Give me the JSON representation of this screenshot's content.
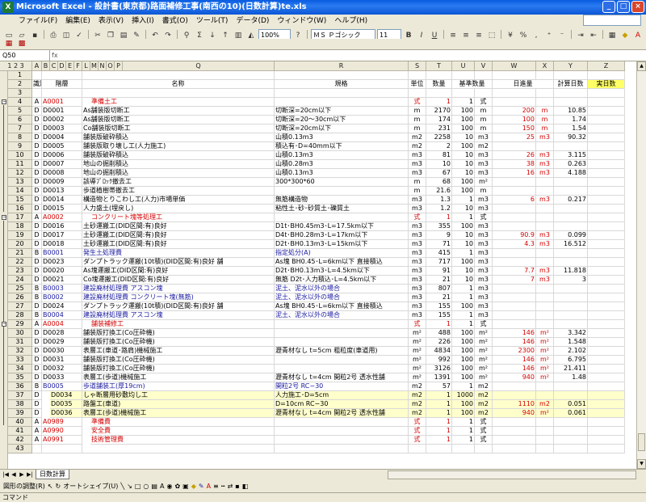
{
  "window": {
    "title": "Microsoft Excel - 設計書(東京都)路面補修工事(南西の10)(日数計算)te.xls"
  },
  "menu": [
    "ファイル(F)",
    "編集(E)",
    "表示(V)",
    "挿入(I)",
    "書式(O)",
    "ツール(T)",
    "データ(D)",
    "ウィンドウ(W)",
    "ヘルプ(H)"
  ],
  "toolbar": {
    "zoom": "100%",
    "font": "ＭＳ Ｐゴシック",
    "size": "11"
  },
  "formula": {
    "namebox": "Q50",
    "fx": "fx"
  },
  "columns": [
    {
      "k": "A",
      "w": 12
    },
    {
      "k": "B",
      "w": 10
    },
    {
      "k": "C",
      "w": 10
    },
    {
      "k": "D",
      "w": 10
    },
    {
      "k": "E",
      "w": 10
    },
    {
      "k": "F",
      "w": 10
    },
    {
      "k": "L",
      "w": 10
    },
    {
      "k": "M",
      "w": 10
    },
    {
      "k": "N",
      "w": 10
    },
    {
      "k": "O",
      "w": 10
    },
    {
      "k": "P",
      "w": 10
    },
    {
      "k": "Q",
      "w": 188
    },
    {
      "k": "R",
      "w": 166
    },
    {
      "k": "S",
      "w": 22
    },
    {
      "k": "T",
      "w": 32
    },
    {
      "k": "U",
      "w": 28
    },
    {
      "k": "V",
      "w": 22
    },
    {
      "k": "W",
      "w": 54
    },
    {
      "k": "X",
      "w": 22
    },
    {
      "k": "Y",
      "w": 42
    },
    {
      "k": "Z",
      "w": 46
    }
  ],
  "header_row": {
    "a": "識別",
    "b": "階層",
    "q": "名称",
    "r": "規格",
    "s": "単位",
    "t": "数量",
    "u": "基準数量",
    "w": "日進量",
    "y": "計算日数",
    "z": "実日数"
  },
  "rows": [
    {
      "n": "1"
    },
    {
      "n": "2"
    },
    {
      "n": "3"
    },
    {
      "n": "4",
      "a": "A",
      "b": "A0001",
      "q": "準備土工",
      "s": "式",
      "t": "1",
      "u": "1",
      "v": "式",
      "ac": "red"
    },
    {
      "n": "5",
      "a": "D",
      "b": "D0001",
      "q": "As舗装版切断工",
      "r": "切断深=20cm以下",
      "s": "m",
      "t": "2170",
      "u": "100",
      "v": "m",
      "w": "200",
      "x": "m",
      "y": "10.85"
    },
    {
      "n": "6",
      "a": "D",
      "b": "D0002",
      "q": "As舗装版切断工",
      "r": "切断深=20〜30cm以下",
      "s": "m",
      "t": "174",
      "u": "100",
      "v": "m",
      "w": "100",
      "x": "m",
      "y": "1.74"
    },
    {
      "n": "7",
      "a": "D",
      "b": "D0003",
      "q": "Co舗装版切断工",
      "r": "切断深=20cm以下",
      "s": "m",
      "t": "231",
      "u": "100",
      "v": "m",
      "w": "150",
      "x": "m",
      "y": "1.54"
    },
    {
      "n": "8",
      "a": "D",
      "b": "D0004",
      "q": "舗装版破砕積込",
      "r": "山積0.13m3",
      "s": "m2",
      "t": "2258",
      "u": "10",
      "v": "m3",
      "w": "25",
      "x": "m3",
      "y": "90.32"
    },
    {
      "n": "9",
      "a": "D",
      "b": "D0005",
      "q": "舗装版取り壊し工(人力施工)",
      "r": "積込有･D=40mm以下",
      "s": "m2",
      "t": "2",
      "u": "100",
      "v": "m2"
    },
    {
      "n": "10",
      "a": "D",
      "b": "D0006",
      "q": "舗装版破砕積込",
      "r": "山積0.13m3",
      "s": "m3",
      "t": "81",
      "u": "10",
      "v": "m3",
      "w": "26",
      "x": "m3",
      "y": "3.115"
    },
    {
      "n": "11",
      "a": "D",
      "b": "D0007",
      "q": "地山の掘削積込",
      "r": "山積0.28m3",
      "s": "m3",
      "t": "10",
      "u": "10",
      "v": "m3",
      "w": "38",
      "x": "m3",
      "y": "0.263"
    },
    {
      "n": "12",
      "a": "D",
      "b": "D0008",
      "q": "地山の掘削積込",
      "r": "山積0.13m3",
      "s": "m3",
      "t": "67",
      "u": "10",
      "v": "m3",
      "w": "16",
      "x": "m3",
      "y": "4.188"
    },
    {
      "n": "13",
      "a": "D",
      "b": "D0009",
      "q": "該導ﾌﾞﾛｯｸ撤去工",
      "r": "300*300*60",
      "s": "m",
      "t": "68",
      "u": "100",
      "v": "m²"
    },
    {
      "n": "14",
      "a": "D",
      "b": "D0013",
      "q": "歩道植樹帯撤去工",
      "s": "m",
      "t": "21.6",
      "u": "100",
      "v": "m"
    },
    {
      "n": "15",
      "a": "D",
      "b": "D0014",
      "q": "構造物とりこわし工(人力)市場単価",
      "r": "無筋構造物",
      "s": "m3",
      "t": "1.3",
      "u": "1",
      "v": "m3",
      "w": "6",
      "x": "m3",
      "y": "0.217"
    },
    {
      "n": "16",
      "a": "D",
      "b": "D0015",
      "q": "人力盛土(埋戻し)",
      "r": "粘性土･砂･砂質土･礫質土",
      "s": "m3",
      "t": "1.2",
      "u": "10",
      "v": "m3"
    },
    {
      "n": "17",
      "a": "A",
      "b": "A0002",
      "q": "コンクリート塊等処理工",
      "s": "式",
      "t": "1",
      "u": "1",
      "v": "式",
      "ac": "red"
    },
    {
      "n": "18",
      "a": "D",
      "b": "D0016",
      "q": "土砂運搬工(DID区間:有)良好",
      "r": "D1t･BH0.45m3･L=17.5km以下",
      "s": "m3",
      "t": "355",
      "u": "100",
      "v": "m3"
    },
    {
      "n": "19",
      "a": "D",
      "b": "D0017",
      "q": "土砂運搬工(DID区間:有)良好",
      "r": "D4t･BH0.28m3･L=17km以下",
      "s": "m3",
      "t": "9",
      "u": "10",
      "v": "m3",
      "w": "90.9",
      "x": "m3",
      "y": "0.099"
    },
    {
      "n": "20",
      "a": "D",
      "b": "D0018",
      "q": "土砂運搬工(DID区間:有)良好",
      "r": "D2t･BH0.13m3･L=15km以下",
      "s": "m3",
      "t": "71",
      "u": "10",
      "v": "m3",
      "w": "4.3",
      "x": "m3",
      "y": "16.512"
    },
    {
      "n": "21",
      "a": "B",
      "b": "B0001",
      "q": "発生土処理費",
      "r": "指定処分(A)",
      "s": "m3",
      "t": "415",
      "u": "1",
      "v": "m3",
      "bc": "blue"
    },
    {
      "n": "22",
      "a": "D",
      "b": "D0023",
      "q": "ダンプトラック運搬(10t積)(DID区間:有)良好 舗",
      "r": "As塊 BH0.45･L=6km以下 直接積込",
      "s": "m3",
      "t": "717",
      "u": "100",
      "v": "m3"
    },
    {
      "n": "23",
      "a": "D",
      "b": "D0020",
      "q": "As塊運搬工(DID区間:有)良好",
      "r": "D2t･BH0.13m3･L=4.5km以下",
      "s": "m3",
      "t": "91",
      "u": "10",
      "v": "m3",
      "w": "7.7",
      "x": "m3",
      "y": "11.818"
    },
    {
      "n": "24",
      "a": "D",
      "b": "D0021",
      "q": "Co塊運搬工(DID区間:有)良好",
      "r": "無筋 D2t･人力積込･L=4.5km以下",
      "s": "m3",
      "t": "21",
      "u": "10",
      "v": "m3",
      "w": "7",
      "x": "m3",
      "y": "3"
    },
    {
      "n": "25",
      "a": "B",
      "b": "B0003",
      "q": "建設廃材処理費 アスコン塊",
      "r": "泥土、泥水以外の場合",
      "s": "m3",
      "t": "807",
      "u": "1",
      "v": "m3",
      "bc": "blue"
    },
    {
      "n": "26",
      "a": "B",
      "b": "B0002",
      "q": "建設廃材処理費 コンクリート塊(無筋)",
      "r": "泥土、泥水以外の場合",
      "s": "m3",
      "t": "21",
      "u": "1",
      "v": "m3",
      "bc": "blue"
    },
    {
      "n": "27",
      "a": "D",
      "b": "D0024",
      "q": "ダンプトラック運搬(10t積)(DID区間:有)良好 舗",
      "r": "As塊 BH0.45･L=6km以下 直接積込",
      "s": "m3",
      "t": "155",
      "u": "100",
      "v": "m3"
    },
    {
      "n": "28",
      "a": "B",
      "b": "B0004",
      "q": "建設廃材処理費 アスコン塊",
      "r": "泥土、泥水以外の場合",
      "s": "m3",
      "t": "155",
      "u": "1",
      "v": "m3",
      "bc": "blue"
    },
    {
      "n": "29",
      "a": "A",
      "b": "A0004",
      "q": "舗装補修工",
      "s": "式",
      "t": "1",
      "u": "1",
      "v": "式",
      "ac": "red"
    },
    {
      "n": "30",
      "a": "D",
      "b": "D0028",
      "q": "舗装版打換工(Co圧砕機)",
      "s": "m²",
      "t": "488",
      "u": "100",
      "v": "m²",
      "w": "146",
      "x": "m²",
      "y": "3.342"
    },
    {
      "n": "31",
      "a": "D",
      "b": "D0029",
      "q": "舗装版打換工(Co圧砕機)",
      "s": "m²",
      "t": "226",
      "u": "100",
      "v": "m²",
      "w": "146",
      "x": "m²",
      "y": "1.548"
    },
    {
      "n": "32",
      "a": "D",
      "b": "D0030",
      "q": "表層工(車道･路肩)機械施工",
      "r": "瀝青材なし t=5cm 粗粒度(車道用)",
      "s": "m²",
      "t": "4834",
      "u": "100",
      "v": "m²",
      "w": "2300",
      "x": "m²",
      "y": "2.102"
    },
    {
      "n": "33",
      "a": "D",
      "b": "D0031",
      "q": "舗装版打換工(Co圧砕機)",
      "s": "m²",
      "t": "992",
      "u": "100",
      "v": "m²",
      "w": "146",
      "x": "m²",
      "y": "6.795"
    },
    {
      "n": "34",
      "a": "D",
      "b": "D0032",
      "q": "舗装版打換工(Co圧砕機)",
      "s": "m²",
      "t": "3126",
      "u": "100",
      "v": "m²",
      "w": "146",
      "x": "m²",
      "y": "21.411"
    },
    {
      "n": "35",
      "a": "D",
      "b": "D0033",
      "q": "表層工(歩道)機械施工",
      "r": "瀝青材なし t=4cm 開粒2号 透水性舗",
      "s": "m²",
      "t": "1391",
      "u": "100",
      "v": "m²",
      "w": "940",
      "x": "m²",
      "y": "1.48"
    },
    {
      "n": "36",
      "a": "B",
      "b": "B0005",
      "q": "歩道舗装工(厚19cm)",
      "r": "開粒2号 RC−30",
      "s": "m2",
      "t": "57",
      "u": "1",
      "v": "m2",
      "bc": "blue"
    },
    {
      "n": "37",
      "a": "D",
      "b": "D0034",
      "q": "しゃ断層用砂敷均し工",
      "r": "人力施工･D=5cm",
      "s": "m2",
      "t": "1",
      "u": "1000",
      "v": "m2",
      "ind": true
    },
    {
      "n": "38",
      "a": "D",
      "b": "D0035",
      "q": "路盤工(車道)",
      "r": "D=10cm RC−30",
      "s": "m2",
      "t": "1",
      "u": "100",
      "v": "m2",
      "w": "1110",
      "x": "m2",
      "y": "0.051",
      "ind": true
    },
    {
      "n": "39",
      "a": "D",
      "b": "D0036",
      "q": "表層工(歩道)機械施工",
      "r": "瀝青材なし t=4cm 開粒2号 透水性舗",
      "s": "m2",
      "t": "1",
      "u": "100",
      "v": "m2",
      "w": "940",
      "x": "m²",
      "y": "0.061",
      "ind": true
    },
    {
      "n": "40",
      "a": "A",
      "b": "A0989",
      "q": "準備費",
      "s": "式",
      "t": "1",
      "u": "1",
      "v": "式",
      "ac": "red"
    },
    {
      "n": "41",
      "a": "A",
      "b": "A0990",
      "q": "安全費",
      "s": "式",
      "t": "1",
      "u": "1",
      "v": "式",
      "ac": "red"
    },
    {
      "n": "42",
      "a": "A",
      "b": "A0991",
      "q": "技術管理費",
      "s": "式",
      "t": "1",
      "u": "1",
      "v": "式",
      "ac": "red"
    },
    {
      "n": "43"
    }
  ],
  "sheet": {
    "tab": "日数計算"
  },
  "drawbar": {
    "draw": "図形の調整(R)",
    "autoshape": "オートシェイプ(U)"
  },
  "status": {
    "text": "コマンド"
  }
}
